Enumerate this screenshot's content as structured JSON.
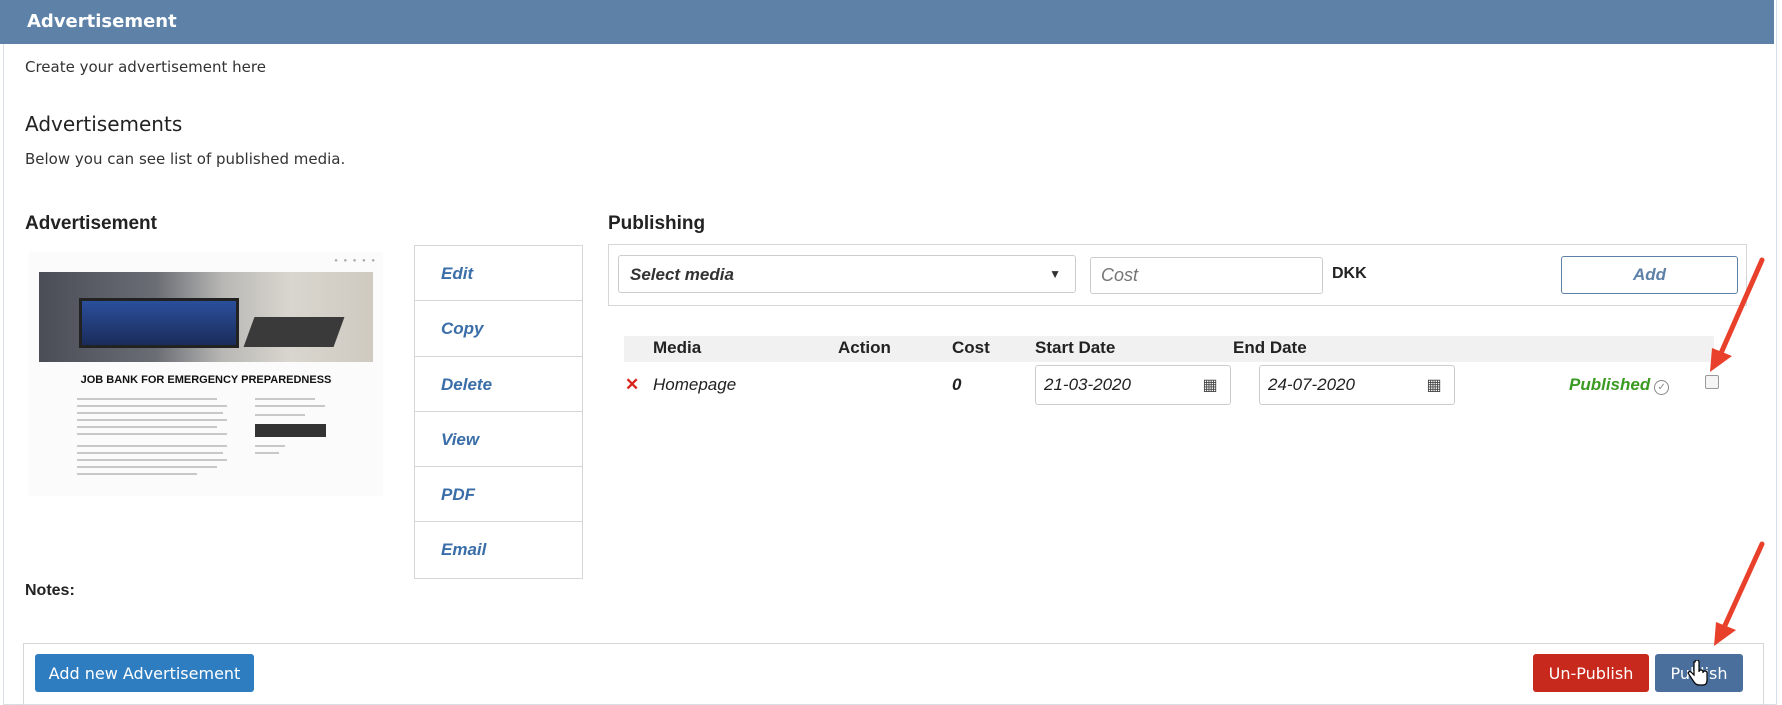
{
  "header": {
    "title": "Advertisement"
  },
  "intro_text": "Create your advertisement here",
  "advertisements": {
    "heading": "Advertisements",
    "subtext": "Below you can see list of published media."
  },
  "advertisement_section": {
    "heading": "Advertisement",
    "thumbnail_title": "JOB BANK FOR EMERGENCY PREPAREDNESS",
    "actions": [
      "Edit",
      "Copy",
      "Delete",
      "View",
      "PDF",
      "Email"
    ]
  },
  "publishing": {
    "heading": "Publishing",
    "select_media": "Select media",
    "cost_placeholder": "Cost",
    "currency": "DKK",
    "add_label": "Add",
    "columns": [
      "Media",
      "Action",
      "Cost",
      "Start Date",
      "End Date"
    ],
    "rows": [
      {
        "media": "Homepage",
        "action": "",
        "cost": "0",
        "start_date": "21-03-2020",
        "end_date": "24-07-2020",
        "status": "Published",
        "checked": false
      }
    ]
  },
  "notes_label": "Notes:",
  "footer": {
    "add_new_label": "Add new Advertisement",
    "unpublish_label": "Un-Publish",
    "publish_label": "Publish"
  },
  "colors": {
    "header_bg": "#5e81a8",
    "link_blue": "#3a6ea8",
    "published_green": "#3a9a22",
    "remove_red": "#d9241b",
    "unpublish_red": "#c8291d",
    "primary_blue": "#2f7dc1",
    "arrow_red": "#e8402a"
  }
}
